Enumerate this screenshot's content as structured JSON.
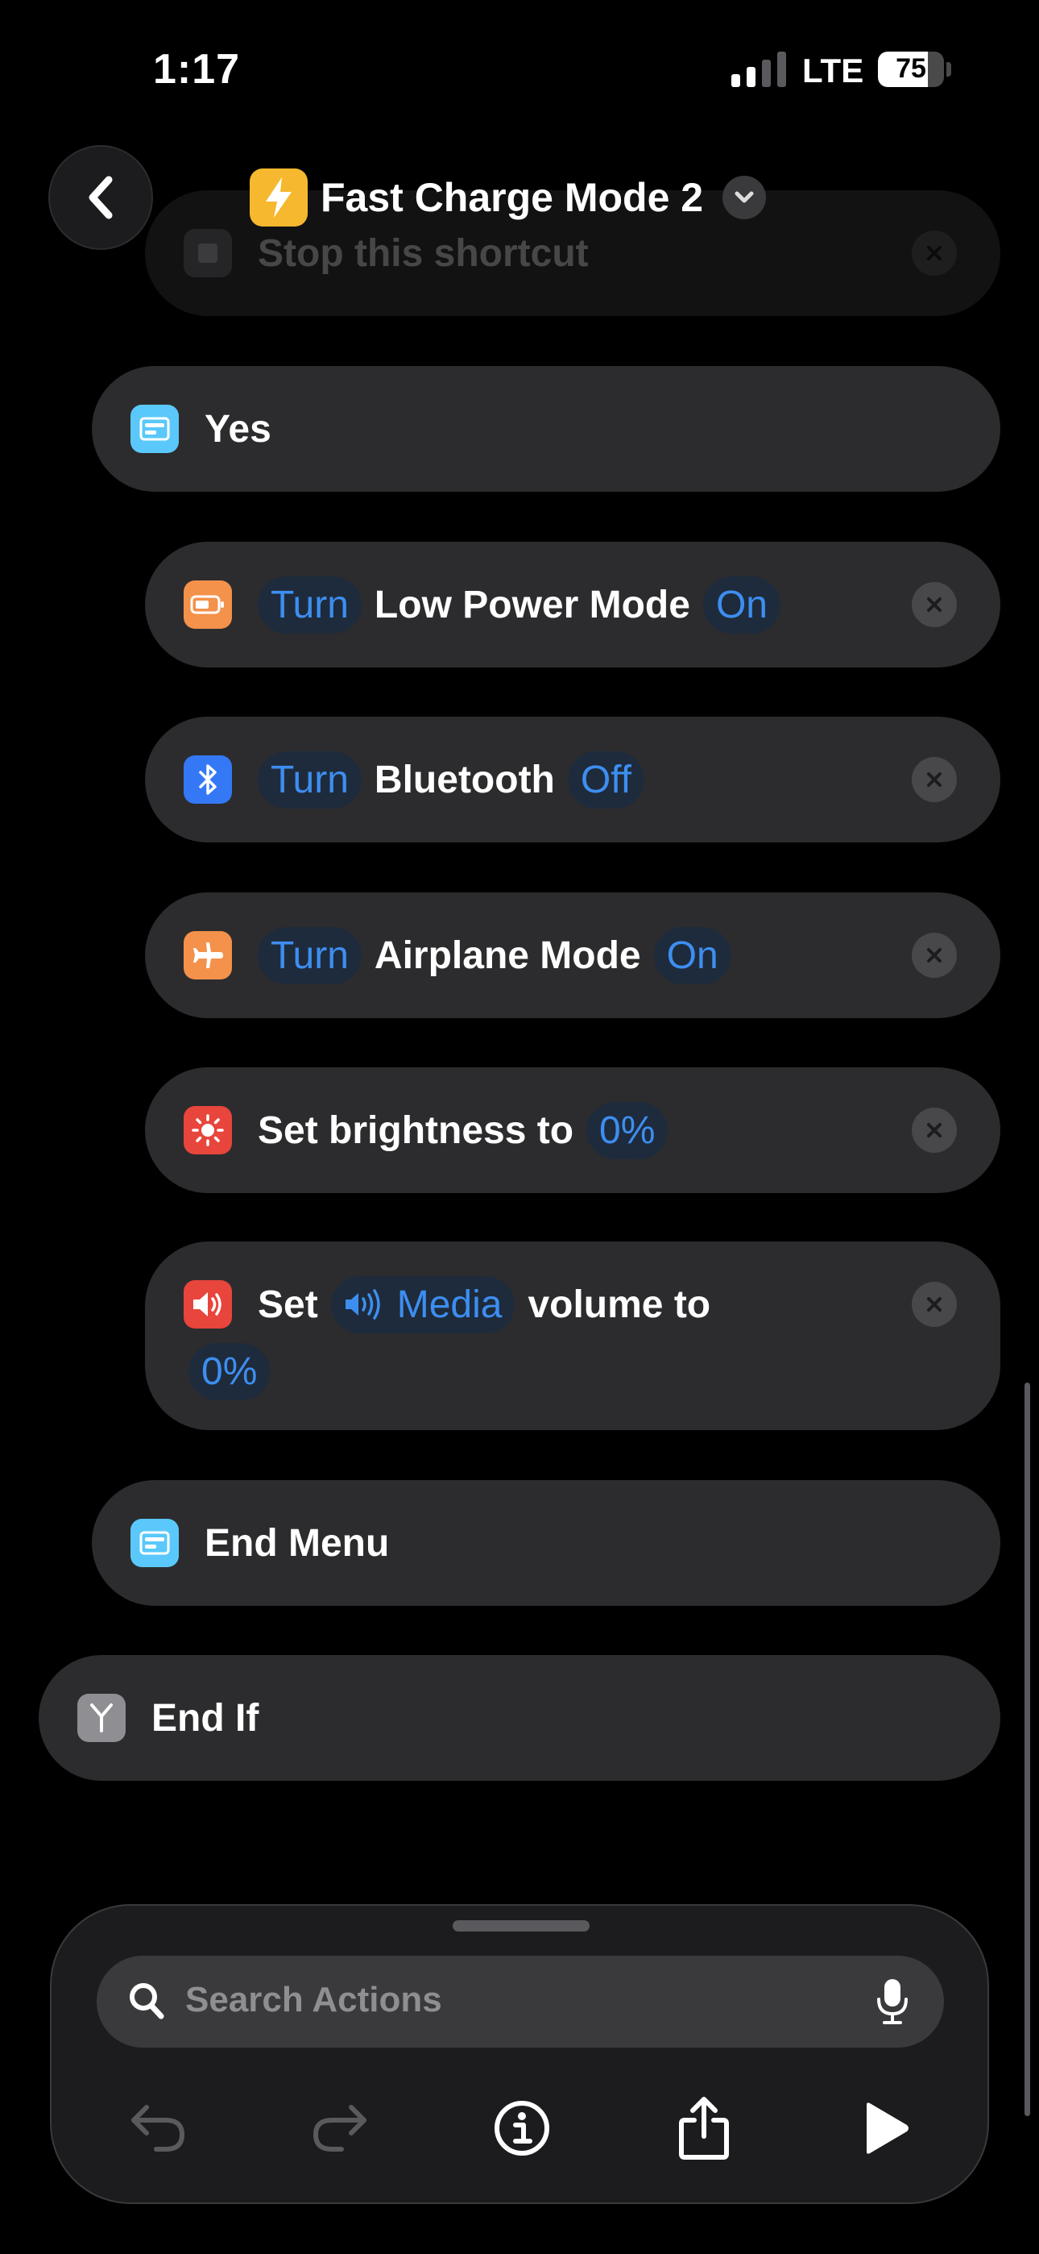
{
  "status_bar": {
    "time": "1:17",
    "network": "LTE",
    "battery_percent": "75",
    "battery_level": 0.75
  },
  "header": {
    "title": "Fast Charge Mode 2",
    "app_icon": "lightning-bolt-icon",
    "back_icon": "chevron-left-icon",
    "menu_icon": "chevron-down-icon"
  },
  "actions": {
    "stop_shortcut": {
      "label": "Stop this shortcut",
      "icon": "stop-square-icon"
    },
    "menu_yes": {
      "label": "Yes",
      "icon": "menu-icon",
      "color": "#5ac8fa"
    },
    "low_power": {
      "verb": "Turn",
      "label": "Low Power Mode",
      "value": "On",
      "icon": "battery-icon",
      "color": "#f4914a"
    },
    "bluetooth": {
      "verb": "Turn",
      "label": "Bluetooth",
      "value": "Off",
      "icon": "bluetooth-icon",
      "color": "#3478f6"
    },
    "airplane": {
      "verb": "Turn",
      "label": "Airplane Mode",
      "value": "On",
      "icon": "airplane-icon",
      "color": "#f4914a"
    },
    "brightness": {
      "label": "Set brightness to",
      "value": "0%",
      "icon": "sun-icon",
      "color": "#e8453c"
    },
    "volume": {
      "label_set": "Set",
      "target": "Media",
      "label_to": "volume to",
      "value": "0%",
      "icon": "speaker-icon",
      "color": "#e8453c"
    },
    "end_menu": {
      "label": "End Menu",
      "icon": "menu-icon",
      "color": "#5ac8fa"
    },
    "end_if": {
      "label": "End If",
      "icon": "branch-icon",
      "color": "#8e8e93"
    }
  },
  "bottom_panel": {
    "search_placeholder": "Search Actions",
    "toolbar": [
      "undo-icon",
      "redo-icon",
      "info-icon",
      "share-icon",
      "play-icon"
    ]
  },
  "colors": {
    "accent": "#3d8ef0",
    "card_bg": "#2c2c2e",
    "token_bg": "#1e2b3c"
  }
}
